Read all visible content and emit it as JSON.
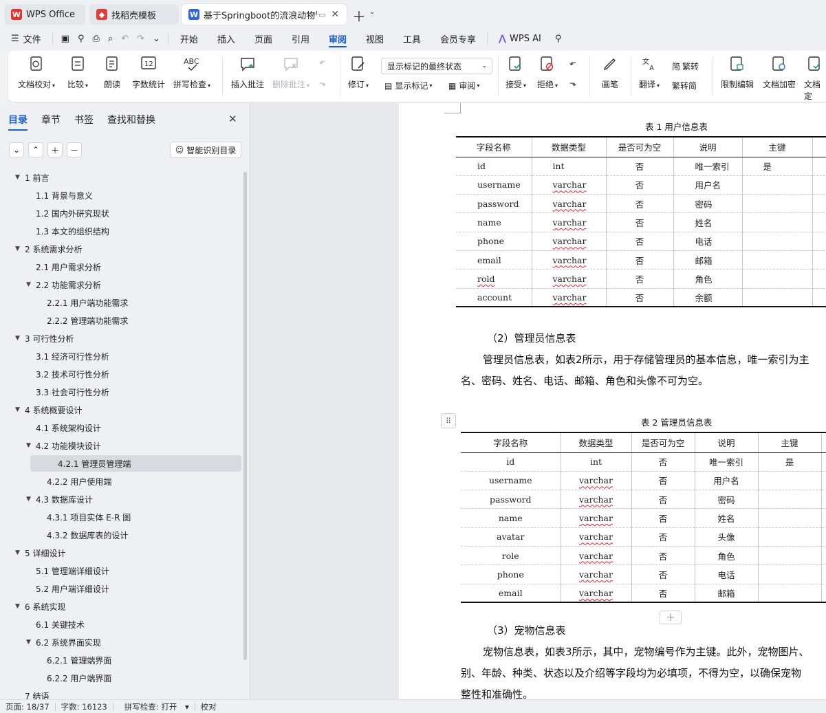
{
  "tabs": [
    {
      "label": "WPS Office"
    },
    {
      "label": "找稻壳模板"
    },
    {
      "label": "基于Springboot的流浪动物管"
    }
  ],
  "menu": {
    "file": "文件",
    "items": [
      "开始",
      "插入",
      "页面",
      "引用",
      "审阅",
      "视图",
      "工具",
      "会员专享"
    ],
    "active": "审阅",
    "ai": "WPS AI"
  },
  "ribbon": {
    "doc_check": "文档校对",
    "compare": "比较",
    "read": "朗读",
    "word_count": "字数统计",
    "spell": "拼写检查",
    "insert_comment": "插入批注",
    "delete_comment": "删除批注",
    "revise": "修订",
    "display_select": "显示标记的最终状态",
    "show_marks": "显示标记",
    "review": "审阅",
    "accept": "接受",
    "reject": "拒绝",
    "to_trad": "繁转",
    "to_simp": "繁转简",
    "pen": "画笔",
    "translate": "翻译",
    "restrict": "限制编辑",
    "encrypt": "文档加密",
    "final": "文档定"
  },
  "leftpane": {
    "tabs": [
      "目录",
      "章节",
      "书签",
      "查找和替换"
    ],
    "smart_btn": "智能识别目录",
    "toc": [
      {
        "text": "1 前言",
        "level": 0,
        "exp": true
      },
      {
        "text": "1.1 背景与意义",
        "level": 1
      },
      {
        "text": "1.2 国内外研究现状",
        "level": 1
      },
      {
        "text": "1.3 本文的组织结构",
        "level": 1
      },
      {
        "text": "2 系统需求分析",
        "level": 0,
        "exp": true
      },
      {
        "text": "2.1 用户需求分析",
        "level": 1
      },
      {
        "text": "2.2 功能需求分析",
        "level": 1,
        "exp": true
      },
      {
        "text": "2.2.1 用户端功能需求",
        "level": 2
      },
      {
        "text": "2.2.2 管理端功能需求",
        "level": 2
      },
      {
        "text": "3 可行性分析",
        "level": 0,
        "exp": true
      },
      {
        "text": "3.1 经济可行性分析",
        "level": 1
      },
      {
        "text": "3.2 技术可行性分析",
        "level": 1
      },
      {
        "text": "3.3 社会可行性分析",
        "level": 1
      },
      {
        "text": "4 系统概要设计",
        "level": 0,
        "exp": true
      },
      {
        "text": "4.1 系统架构设计",
        "level": 1
      },
      {
        "text": "4.2 功能模块设计",
        "level": 1,
        "exp": true
      },
      {
        "text": "4.2.1 管理员管理端",
        "level": 2,
        "sel": true
      },
      {
        "text": "4.2.2 用户使用端",
        "level": 2
      },
      {
        "text": "4.3 数据库设计",
        "level": 1,
        "exp": true
      },
      {
        "text": "4.3.1 项目实体 E-R 图",
        "level": 2
      },
      {
        "text": "4.3.2 数据库表的设计",
        "level": 2
      },
      {
        "text": "5 详细设计",
        "level": 0,
        "exp": true
      },
      {
        "text": "5.1 管理端详细设计",
        "level": 1
      },
      {
        "text": "5.2 用户端详细设计",
        "level": 1
      },
      {
        "text": "6  系统实现",
        "level": 0,
        "exp": true
      },
      {
        "text": "6.1 关键技术",
        "level": 1
      },
      {
        "text": "6.2 系统界面实现",
        "level": 1,
        "exp": true
      },
      {
        "text": "6.2.1 管理端界面",
        "level": 2
      },
      {
        "text": "6.2.2 用户端界面",
        "level": 2
      },
      {
        "text": "7 结语",
        "level": 0
      }
    ]
  },
  "doc": {
    "table1": {
      "caption": "表 1 用户信息表",
      "headers": [
        "字段名称",
        "数据类型",
        "是否可为空",
        "说明",
        "主键"
      ],
      "rows": [
        [
          "id",
          "int",
          "否",
          "唯一索引",
          "是"
        ],
        [
          "username",
          "varchar",
          "否",
          "用户名",
          ""
        ],
        [
          "password",
          "varchar",
          "否",
          "密码",
          ""
        ],
        [
          "name",
          "varchar",
          "否",
          "姓名",
          ""
        ],
        [
          "phone",
          "varchar",
          "否",
          "电话",
          ""
        ],
        [
          "email",
          "varchar",
          "否",
          "邮箱",
          ""
        ],
        [
          "rold",
          "varchar",
          "否",
          "角色",
          ""
        ],
        [
          "account",
          "varchar",
          "否",
          "余额",
          ""
        ]
      ]
    },
    "section2": "（2）管理员信息表",
    "para2_line1": "管理员信息表，如表2所示，用于存储管理员的基本信息，唯一索引为主",
    "para2_line2": "名、密码、姓名、电话、邮箱、角色和头像不可为空。",
    "table2": {
      "caption": "表 2 管理员信息表",
      "headers": [
        "字段名称",
        "数据类型",
        "是否可为空",
        "说明",
        "主键"
      ],
      "rows": [
        [
          "id",
          "int",
          "否",
          "唯一索引",
          "是"
        ],
        [
          "username",
          "varchar",
          "否",
          "用户名",
          ""
        ],
        [
          "password",
          "varchar",
          "否",
          "密码",
          ""
        ],
        [
          "name",
          "varchar",
          "否",
          "姓名",
          ""
        ],
        [
          "avatar",
          "varchar",
          "否",
          "头像",
          ""
        ],
        [
          "role",
          "varchar",
          "否",
          "角色",
          ""
        ],
        [
          "phone",
          "varchar",
          "否",
          "电话",
          ""
        ],
        [
          "email",
          "varchar",
          "否",
          "邮箱",
          ""
        ]
      ]
    },
    "section3": "（3）宠物信息表",
    "para3_line1": "宠物信息表，如表3所示，其中，宠物编号作为主键。此外，宠物图片、",
    "para3_line2": "别、年龄、种类、状态以及介绍等字段均为必填项，不得为空，以确保宠物",
    "para3_line3": "整性和准确性。"
  },
  "status": {
    "page": "页面: 18/37",
    "words": "字数: 16123",
    "spell": "拼写检查: 打开",
    "proof": "校对"
  }
}
